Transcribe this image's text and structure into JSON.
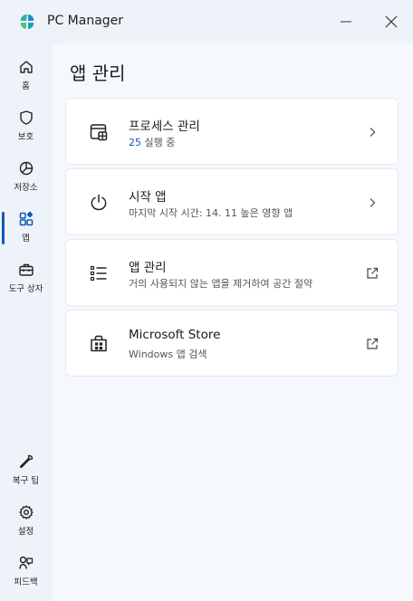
{
  "window": {
    "title": "PC Manager"
  },
  "sidebar": {
    "items": [
      {
        "label": "홈",
        "icon": "home-icon"
      },
      {
        "label": "보호",
        "icon": "shield-icon"
      },
      {
        "label": "저장소",
        "icon": "pie-chart-icon"
      },
      {
        "label": "앱",
        "icon": "apps-icon",
        "active": true
      },
      {
        "label": "도구 상자",
        "icon": "toolbox-icon"
      },
      {
        "label": "복구 팁",
        "icon": "wrench-icon"
      },
      {
        "label": "설정",
        "icon": "gear-icon"
      },
      {
        "label": "피드백",
        "icon": "feedback-icon"
      }
    ]
  },
  "main": {
    "title": "앱 관리",
    "cards": [
      {
        "title": "프로세스 관리",
        "subtitle_prefix": "25",
        "subtitle": " 실행 중",
        "icon": "process-icon",
        "action": "chevron-right-icon"
      },
      {
        "title": "시작 앱",
        "subtitle": "마지막 시작 시간: 14. 11 높은 영향 앱",
        "icon": "power-icon",
        "action": "chevron-right-icon"
      },
      {
        "title": "앱 관리",
        "subtitle": "거의 사용되지 않는 앱을 제거하여 공간 절약",
        "icon": "list-icon",
        "action": "open-external-icon"
      },
      {
        "title": "Microsoft Store",
        "subtitle": "Windows 앱 검색",
        "icon": "store-icon",
        "action": "open-external-icon"
      }
    ]
  },
  "colors": {
    "accent": "#0a5bb5",
    "background": "#eef3f9",
    "panel": "#f5f8fc",
    "card": "#ffffff"
  }
}
